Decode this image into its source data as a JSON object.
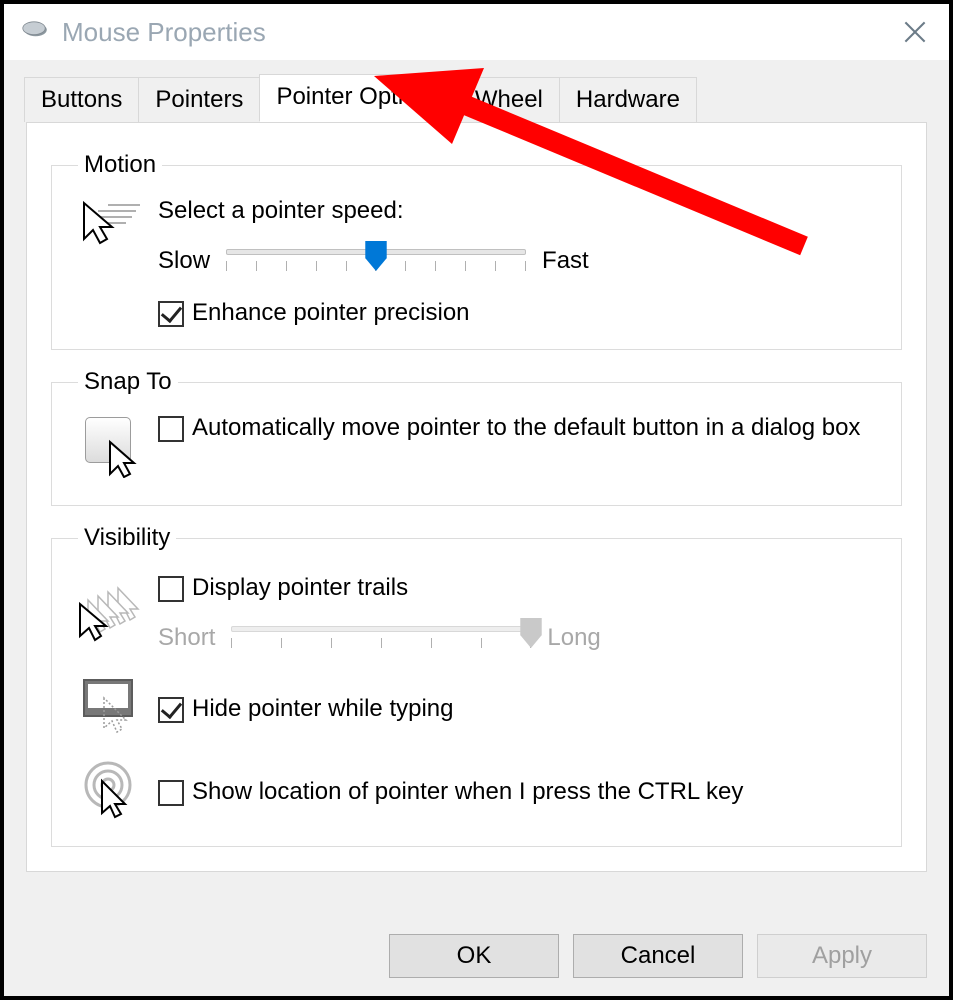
{
  "window": {
    "title": "Mouse Properties"
  },
  "tabs": {
    "items": [
      "Buttons",
      "Pointers",
      "Pointer Options",
      "Wheel",
      "Hardware"
    ],
    "active_index": 2
  },
  "groups": {
    "motion": {
      "legend": "Motion",
      "prompt": "Select a pointer speed:",
      "slow_label": "Slow",
      "fast_label": "Fast",
      "speed": {
        "min": 1,
        "max": 11,
        "value": 6
      },
      "enhance_precision": {
        "label": "Enhance pointer precision",
        "checked": true
      }
    },
    "snap_to": {
      "legend": "Snap To",
      "auto_move": {
        "label": "Automatically move pointer to the default button in a dialog box",
        "checked": false
      }
    },
    "visibility": {
      "legend": "Visibility",
      "trails": {
        "label": "Display pointer trails",
        "checked": false
      },
      "trails_short": "Short",
      "trails_long": "Long",
      "trails_slider": {
        "min": 1,
        "max": 7,
        "value": 7,
        "enabled": false
      },
      "hide_typing": {
        "label": "Hide pointer while typing",
        "checked": true
      },
      "show_ctrl": {
        "label": "Show location of pointer when I press the CTRL key",
        "checked": false
      }
    }
  },
  "buttons": {
    "ok": "OK",
    "cancel": "Cancel",
    "apply": "Apply",
    "apply_enabled": false
  },
  "colors": {
    "accent": "#0078d7",
    "annotation": "#ff0000"
  }
}
